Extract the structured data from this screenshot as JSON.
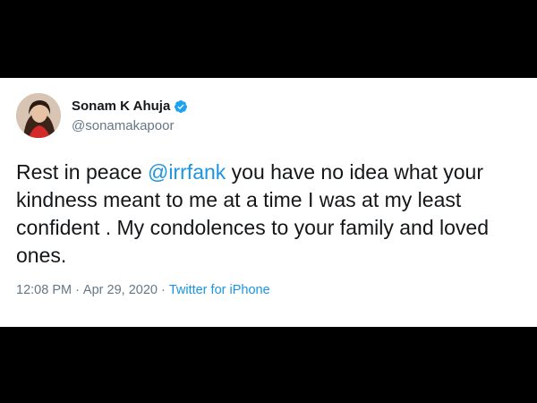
{
  "tweet": {
    "author": {
      "display_name": "Sonam K Ahuja",
      "handle": "@sonamakapoor",
      "verified": true
    },
    "text_before": "Rest in peace ",
    "mention": "@irrfank",
    "text_after": " you have no idea what your kindness meant to me at a time I was at my least confident . My condolences to your family and loved ones.",
    "time": "12:08 PM",
    "separator_1": "·",
    "date": "Apr 29, 2020",
    "separator_2": "·",
    "source": "Twitter for iPhone"
  },
  "colors": {
    "accent": "#1b95e0",
    "text": "#14171a",
    "muted": "#657786",
    "background_frame": "#000000"
  },
  "icons": {
    "verified": "verified-badge-icon"
  }
}
